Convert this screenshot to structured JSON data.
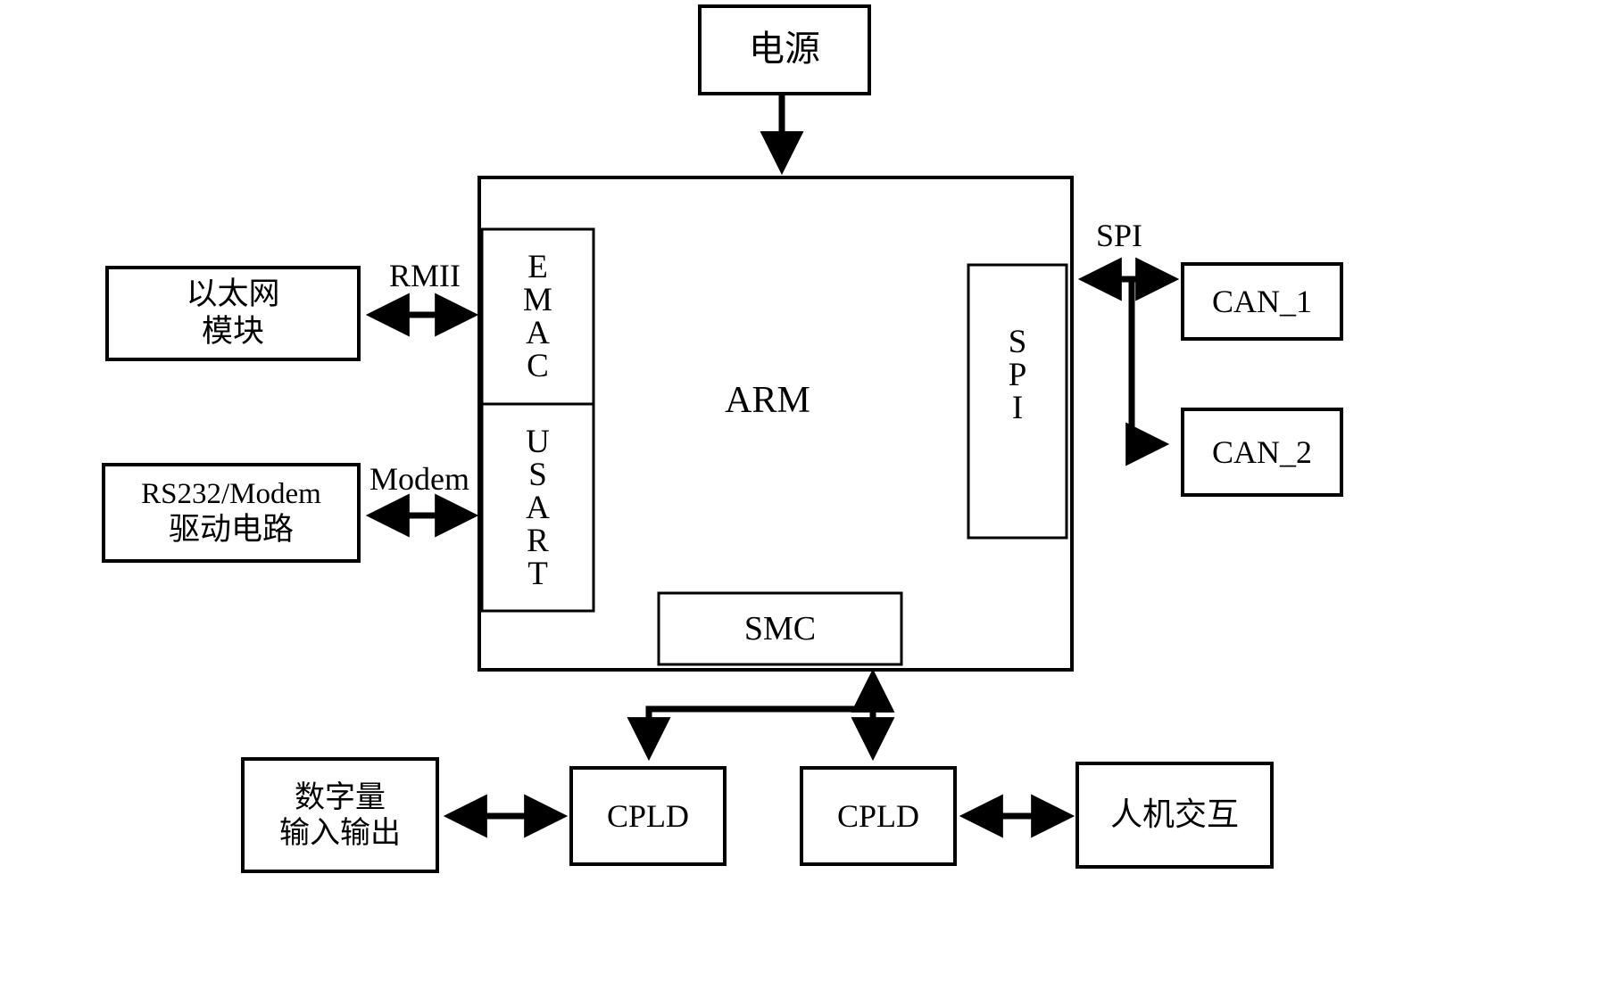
{
  "diagram": {
    "title": "ARM embedded controller hardware block diagram",
    "stroke_color": "#000000",
    "background_color": "#ffffff",
    "blocks": {
      "power": {
        "label": "电源"
      },
      "arm": {
        "label": "ARM"
      },
      "emac": {
        "label": "EMAC",
        "letters": [
          "E",
          "M",
          "A",
          "C"
        ]
      },
      "usart": {
        "label": "USART",
        "letters": [
          "U",
          "S",
          "A",
          "R",
          "T"
        ]
      },
      "spi_internal": {
        "label": "SPI",
        "letters": [
          "S",
          "P",
          "I"
        ]
      },
      "smc": {
        "label": "SMC"
      },
      "ethernet_module": {
        "line1": "以太网",
        "line2": "模块"
      },
      "rs232_driver": {
        "line1": "RS232/Modem",
        "line2": "驱动电路"
      },
      "can1": {
        "label": "CAN_1"
      },
      "can2": {
        "label": "CAN_2"
      },
      "cpld_left": {
        "label": "CPLD"
      },
      "cpld_right": {
        "label": "CPLD"
      },
      "digital_io": {
        "line1": "数字量",
        "line2": "输入输出"
      },
      "hmi": {
        "label": "人机交互"
      }
    },
    "connection_labels": {
      "rmii": "RMII",
      "modem": "Modem",
      "spi_bus": "SPI"
    },
    "connections": [
      {
        "from": "power",
        "to": "arm",
        "direction": "one-way",
        "label": ""
      },
      {
        "from": "ethernet_module",
        "to": "emac",
        "direction": "two-way",
        "label": "RMII"
      },
      {
        "from": "rs232_driver",
        "to": "usart",
        "direction": "two-way",
        "label": "Modem"
      },
      {
        "from": "spi_internal",
        "to": "can1",
        "direction": "two-way",
        "label": "SPI"
      },
      {
        "from": "spi_internal",
        "to": "can2",
        "direction": "one-way",
        "label": ""
      },
      {
        "from": "smc",
        "to": "cpld_left",
        "direction": "one-way",
        "label": ""
      },
      {
        "from": "smc",
        "to": "cpld_right",
        "direction": "two-way",
        "label": ""
      },
      {
        "from": "digital_io",
        "to": "cpld_left",
        "direction": "two-way",
        "label": ""
      },
      {
        "from": "cpld_right",
        "to": "hmi",
        "direction": "two-way",
        "label": ""
      }
    ]
  }
}
